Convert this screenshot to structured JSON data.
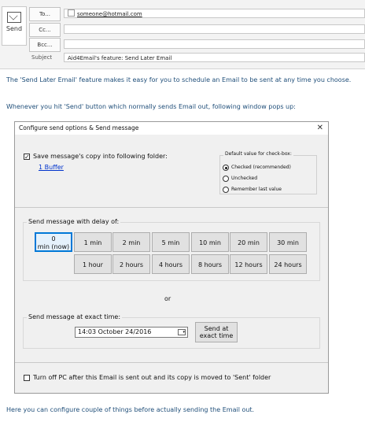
{
  "compose": {
    "send_label": "Send",
    "to_label": "To...",
    "cc_label": "Cc...",
    "bcc_label": "Bcc...",
    "subject_label": "Subject",
    "to_value": "someone@hotmail.com",
    "subject_value": "Aid4Email's feature: Send Later Email"
  },
  "body": {
    "intro": "The 'Send Later Email' feature makes it easy for you to schedule an Email to be sent at any time you choose.",
    "popup_note": "Whenever you hit 'Send' button which normally sends Email out, following window pops up:",
    "outro": "Here you can configure couple of things before actually sending the Email out."
  },
  "dialog": {
    "title": "Configure send options & Send message",
    "close_glyph": "✕",
    "save_copy_label": "Save message's copy into following folder:",
    "save_copy_checked": true,
    "folder_link": "1 Buffer",
    "default_group": {
      "title": "Default value for check-box:",
      "options": [
        "Checked (recommended)",
        "Unchecked",
        "Remember last value"
      ],
      "selected_index": 0
    },
    "delay_group_title": "Send message with delay of:",
    "delay_row1": [
      "0 min (now)",
      "1 min",
      "2 min",
      "5 min",
      "10 min",
      "20 min",
      "30 min"
    ],
    "delay_row2": [
      "1 hour",
      "2 hours",
      "4 hours",
      "8 hours",
      "12 hours",
      "24 hours"
    ],
    "selected_delay": "0 min (now)",
    "or_label": "or",
    "exact_group_title": "Send message at exact time:",
    "exact_datetime": "14:03   October   24/2016",
    "send_exact_label_line1": "Send at",
    "send_exact_label_line2": "exact time",
    "turn_off_label": "Turn off PC after this Email is sent out and its copy is moved to 'Sent' folder",
    "turn_off_checked": false
  }
}
